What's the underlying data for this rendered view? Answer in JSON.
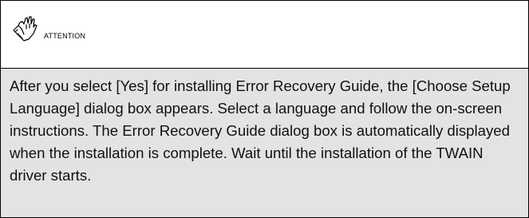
{
  "attention": {
    "label": "ATTENTION",
    "icon": "hand-pointing-icon",
    "text": "After you select [Yes] for installing Error Recovery Guide, the [Choose Setup Language] dialog box appears. Select a language and follow the on-screen instructions. The Error Recovery Guide dialog box is automatically displayed when the installation is complete. Wait until the installation of the TWAIN driver starts."
  },
  "colors": {
    "border": "#000000",
    "body_background": "#e3e3e3",
    "header_background": "#ffffff"
  }
}
